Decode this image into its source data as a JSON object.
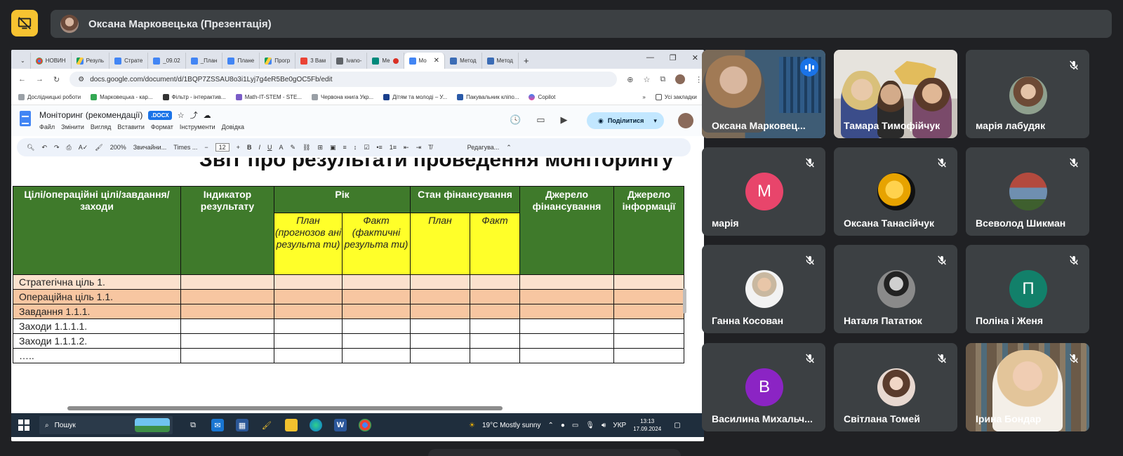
{
  "meet": {
    "presenter_banner": "Оксана Марковецька (Презентація)",
    "colors": {
      "present_button": "#f7c331",
      "tile_bg": "#3c4043",
      "page_bg": "#202124"
    }
  },
  "browser": {
    "tabs": [
      {
        "label": "НОВИН",
        "icon": "chrome-icon"
      },
      {
        "label": "Резуль",
        "icon": "drive-icon"
      },
      {
        "label": "Страте",
        "icon": "docs-icon"
      },
      {
        "label": "_09.02",
        "icon": "docs-icon"
      },
      {
        "label": "_План",
        "icon": "docs-icon"
      },
      {
        "label": "Плане",
        "icon": "docs-icon"
      },
      {
        "label": "Прогр",
        "icon": "drive-icon"
      },
      {
        "label": "3 Вам",
        "icon": "gmail-icon"
      },
      {
        "label": "Ivano-",
        "icon": "site-icon"
      },
      {
        "label": "Me",
        "icon": "meet-icon"
      },
      {
        "label": "Mo",
        "icon": "docs-icon",
        "active": true
      },
      {
        "label": "Метод",
        "icon": "site-icon"
      },
      {
        "label": "Метод",
        "icon": "site-icon"
      }
    ],
    "url": "docs.google.com/document/d/1BQP7ZSSAU8o3i1Lyj7g4eR5Be0gOC5Fb/edit",
    "bookmarks": [
      "Дослідницькі роботи",
      "Марковецька - кар...",
      "Фільтр - інтерактив...",
      "Math-IT-STEM - STE...",
      "Червона книга Укр...",
      "Дітям та молоді – У...",
      "Пакувальник кліпо...",
      "Copilot",
      "Усі закладки"
    ]
  },
  "doc": {
    "title": "Моніторинг (рекомендації)",
    "badge": ".DOCX",
    "menu": [
      "Файл",
      "Змінити",
      "Вигляд",
      "Вставити",
      "Формат",
      "Інструменти",
      "Довідка"
    ],
    "share_label": "Поділитися",
    "toolbar": {
      "zoom": "200%",
      "style": "Звичайни...",
      "font": "Times ...",
      "font_size": "12",
      "mode": "Редагува..."
    },
    "heading": "Звіт про результати проведення моніторингу",
    "table": {
      "headers": {
        "c1": "Цілі/операційні цілі/завдання/заходи",
        "c2": "Індикатор результату",
        "c3": "Рік",
        "c4": "Стан фінансування",
        "c5": "Джерело фінансування",
        "c6": "Джерело інформації"
      },
      "subheaders": {
        "plan_year": "План (прогнозов ані результа ти)",
        "fact_year": "Факт (фактичні результа ти)",
        "plan_fin": "План",
        "fact_fin": "Факт"
      },
      "rows": [
        "Стратегічна ціль 1.",
        "Операційна ціль 1.1.",
        "Завдання 1.1.1.",
        "Заходи 1.1.1.1.",
        "Заходи 1.1.1.2.",
        "….."
      ]
    }
  },
  "taskbar": {
    "search": "Пошук",
    "weather": "19°C  Mostly sunny",
    "lang": "УКР",
    "time": "13:13",
    "date": "17.09.2024"
  },
  "participants": [
    {
      "name": "Оксана Марковец...",
      "type": "video"
    },
    {
      "name": "Тамара Тимофійчук",
      "type": "video"
    },
    {
      "name": "марія лабудяк",
      "type": "photo"
    },
    {
      "name": "марія",
      "type": "letter",
      "letter": "М",
      "color": "#e8456b"
    },
    {
      "name": "Оксана Танасійчук",
      "type": "photo"
    },
    {
      "name": "Всеволод Шикман",
      "type": "photo"
    },
    {
      "name": "Ганна Косован",
      "type": "photo"
    },
    {
      "name": "Наталя Пататюк",
      "type": "photo"
    },
    {
      "name": "Поліна і Женя",
      "type": "letter",
      "letter": "П",
      "color": "#12806a"
    },
    {
      "name": "Василина Михальч...",
      "type": "letter",
      "letter": "В",
      "color": "#8b24c4"
    },
    {
      "name": "Світлана Томей",
      "type": "photo"
    },
    {
      "name": "Ірина Бондар",
      "type": "video"
    }
  ]
}
